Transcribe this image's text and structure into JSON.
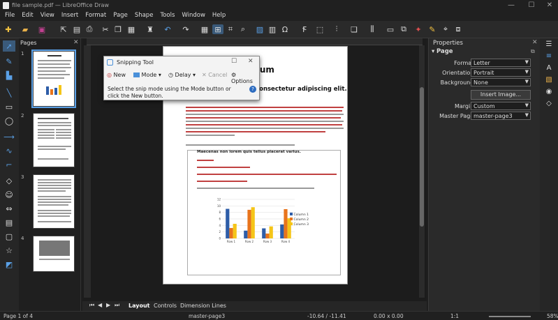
{
  "window": {
    "title": "file sample.pdf — LibreOffice Draw",
    "minimize": "—",
    "maximize": "☐",
    "close": "✕"
  },
  "menu": [
    "File",
    "Edit",
    "View",
    "Insert",
    "Format",
    "Page",
    "Shape",
    "Tools",
    "Window",
    "Help"
  ],
  "pages_panel": {
    "title": "Pages",
    "close": "✕",
    "page_numbers": [
      "1",
      "2",
      "3",
      "4"
    ]
  },
  "document": {
    "heading_partial": "ipsum",
    "subheading_partial": "net, consectetur adipiscing elit.",
    "list_bold": "Maecenas non lorem quis tellus placerat varius.",
    "chart_legend": [
      "Column 1",
      "Column 2",
      "Column 3"
    ],
    "chart_categories": [
      "Row 1",
      "Row 2",
      "Row 3",
      "Row 4"
    ]
  },
  "chart_data": {
    "type": "bar",
    "categories": [
      "Row 1",
      "Row 2",
      "Row 3",
      "Row 4"
    ],
    "series": [
      {
        "name": "Column 1",
        "values": [
          9.1,
          2.4,
          3.1,
          4.3
        ]
      },
      {
        "name": "Column 2",
        "values": [
          3.2,
          8.8,
          1.5,
          9.0
        ]
      },
      {
        "name": "Column 3",
        "values": [
          4.5,
          9.6,
          3.7,
          6.2
        ]
      }
    ],
    "ylim": [
      0,
      12
    ],
    "yticks": [
      "0",
      "2",
      "4",
      "6",
      "8",
      "10",
      "12"
    ],
    "colors": [
      "#2e5da8",
      "#e8741c",
      "#f5c518"
    ]
  },
  "snipping_tool": {
    "title": "Snipping Tool",
    "new_label": "New",
    "mode_label": "Mode",
    "delay_label": "Delay",
    "cancel_label": "Cancel",
    "options_label": "Options",
    "message": "Select the snip mode using the Mode button or click the New button."
  },
  "tabs": {
    "layout": "Layout",
    "controls": "Controls",
    "dimension_lines": "Dimension Lines"
  },
  "properties": {
    "title": "Properties",
    "section": "Page",
    "format_label": "Format:",
    "format_value": "Letter",
    "orientation_label": "Orientation:",
    "orientation_value": "Portrait",
    "background_label": "Background:",
    "background_value": "None",
    "insert_image": "Insert Image...",
    "margin_label": "Margin:",
    "margin_value": "Custom",
    "master_page_label": "Master Page:",
    "master_page_value": "master-page3"
  },
  "status": {
    "page": "Page 1 of 4",
    "master": "master-page3",
    "position": "-10.64 / -11.41",
    "size": "0.00 x 0.00",
    "scale": "1:1",
    "zoom": "58%"
  }
}
